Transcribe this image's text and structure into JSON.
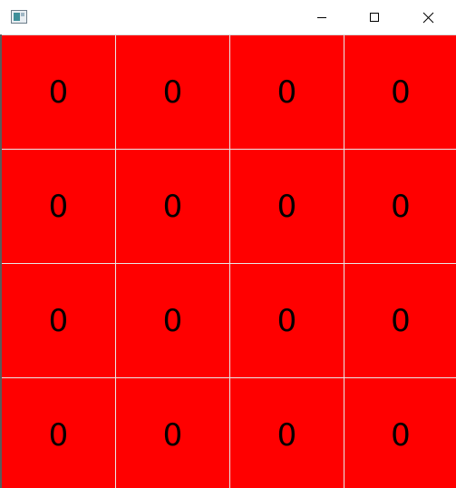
{
  "window": {
    "icon": "app-window-icon",
    "controls": {
      "minimize_icon": "minimize-icon",
      "maximize_icon": "maximize-icon",
      "close_icon": "close-icon"
    }
  },
  "colors": {
    "cell_background": "#ff0000",
    "grid_lines": "#e8e8e8",
    "text": "#000000"
  },
  "grid": {
    "rows": [
      [
        "0",
        "0",
        "0",
        "0"
      ],
      [
        "0",
        "0",
        "0",
        "0"
      ],
      [
        "0",
        "0",
        "0",
        "0"
      ],
      [
        "0",
        "0",
        "0",
        "0"
      ]
    ]
  }
}
